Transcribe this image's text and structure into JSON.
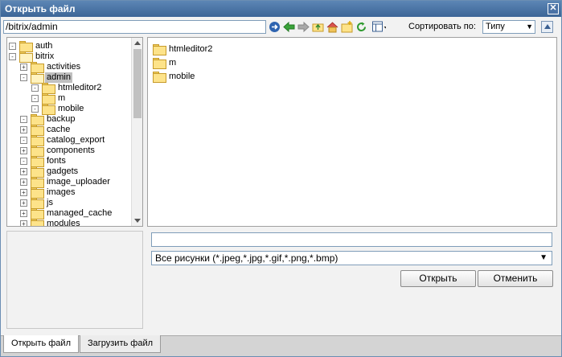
{
  "window": {
    "title": "Открыть файл",
    "close_glyph": "✕"
  },
  "path": {
    "value": "/bitrix/admin"
  },
  "toolbar": {
    "icons": [
      "go-icon",
      "back-icon",
      "forward-icon",
      "up-folder-icon",
      "home-icon",
      "new-folder-icon",
      "refresh-icon",
      "view-mode-icon"
    ]
  },
  "sort": {
    "label": "Сортировать по:",
    "selected": "Типу",
    "direction": "ascending"
  },
  "tree": {
    "items": [
      {
        "label": "auth",
        "toggle": "-",
        "level": 0
      },
      {
        "label": "bitrix",
        "toggle": "-",
        "level": 0,
        "open": true
      },
      {
        "label": "activities",
        "toggle": "+",
        "level": 1
      },
      {
        "label": "admin",
        "toggle": "-",
        "level": 1,
        "open": true,
        "selected": true
      },
      {
        "label": "htmleditor2",
        "toggle": "-",
        "level": 2
      },
      {
        "label": "m",
        "toggle": "-",
        "level": 2
      },
      {
        "label": "mobile",
        "toggle": "-",
        "level": 2
      },
      {
        "label": "backup",
        "toggle": "-",
        "level": 1
      },
      {
        "label": "cache",
        "toggle": "+",
        "level": 1
      },
      {
        "label": "catalog_export",
        "toggle": "-",
        "level": 1
      },
      {
        "label": "components",
        "toggle": "+",
        "level": 1
      },
      {
        "label": "fonts",
        "toggle": "-",
        "level": 1
      },
      {
        "label": "gadgets",
        "toggle": "+",
        "level": 1
      },
      {
        "label": "image_uploader",
        "toggle": "+",
        "level": 1
      },
      {
        "label": "images",
        "toggle": "+",
        "level": 1
      },
      {
        "label": "js",
        "toggle": "+",
        "level": 1
      },
      {
        "label": "managed_cache",
        "toggle": "+",
        "level": 1
      },
      {
        "label": "modules",
        "toggle": "+",
        "level": 1
      }
    ]
  },
  "files": {
    "items": [
      "htmleditor2",
      "m",
      "mobile"
    ]
  },
  "filename": {
    "value": ""
  },
  "filter": {
    "selected": "Все рисунки (*.jpeg,*.jpg,*.gif,*.png,*.bmp)"
  },
  "buttons": {
    "open": "Открыть",
    "cancel": "Отменить"
  },
  "tabs": {
    "open_file": "Открыть файл",
    "upload_file": "Загрузить файл"
  },
  "colors": {
    "title_bar": "#4a72a6",
    "selection": "#c0c0c0",
    "folder": "#fde38a"
  }
}
